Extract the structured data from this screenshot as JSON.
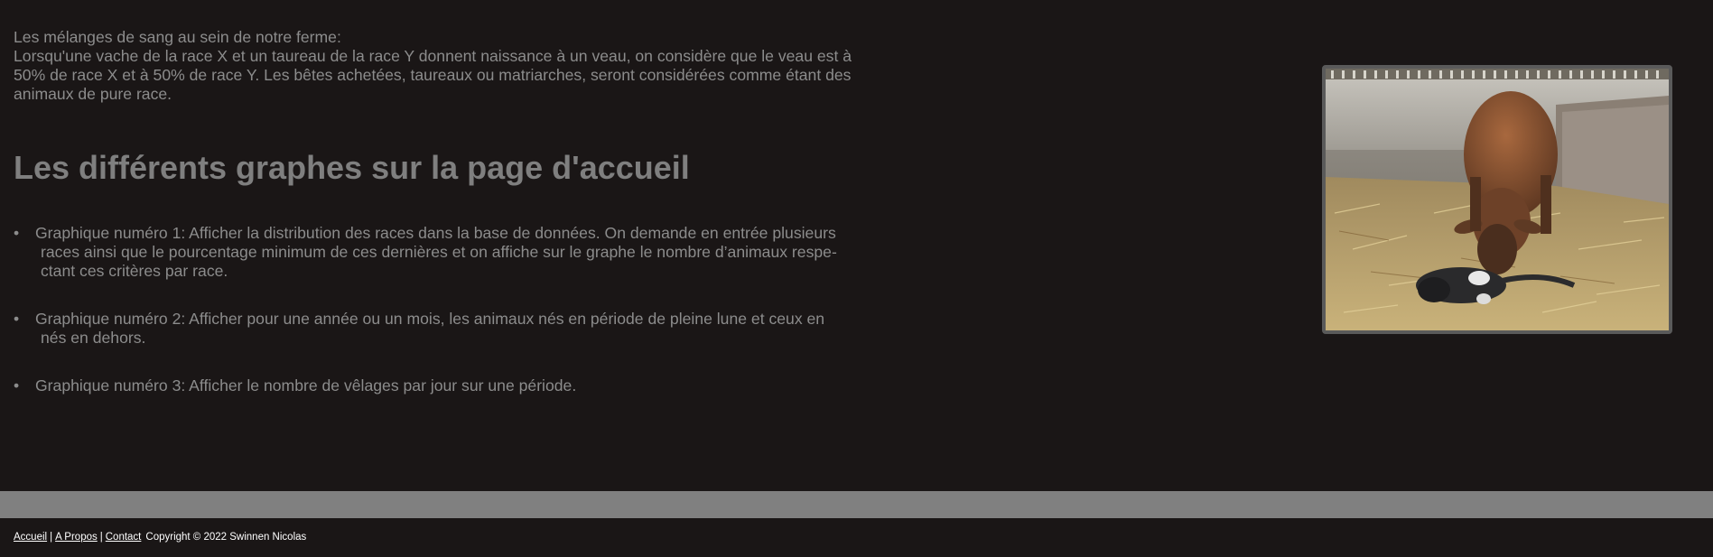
{
  "intro": {
    "heading_line": "Les mélanges de sang au sein de notre ferme:",
    "body": "Lorsqu'une vache de la race X et un taureau de la race Y donnent naissance à un veau, on considère que le veau est à 50% de race X et à 50% de race Y. Les bêtes achetées, taureaux ou matriarches, seront considérées comme étant des animaux de pure race."
  },
  "section": {
    "title": "Les différents graphes sur la page d'accueil"
  },
  "graphs": [
    {
      "line1": "Graphique numéro 1: Afficher la distribution des races dans la base de données. On demande en entrée plusieurs",
      "line2": "races ainsi que le pourcentage minimum de ces dernières et on affiche sur le graphe le nombre d’animaux respe-",
      "line3": "ctant ces critères par race."
    },
    {
      "line1": "Graphique numéro 2: Afficher pour une année ou un mois, les animaux nés en période de pleine lune et ceux en",
      "line2": "nés en dehors."
    },
    {
      "line1": "Graphique numéro 3: Afficher le nombre de vêlages par jour sur une période."
    }
  ],
  "bullet": "•",
  "footer": {
    "links": [
      "Accueil",
      "A Propos",
      "Contact"
    ],
    "separator": "|",
    "copyright": "Copyright © 2022 Swinnen Nicolas"
  },
  "colors": {
    "background": "#1a1616",
    "text": "#8c8c8c",
    "band": "#808080",
    "footer_text": "#ffffff"
  }
}
